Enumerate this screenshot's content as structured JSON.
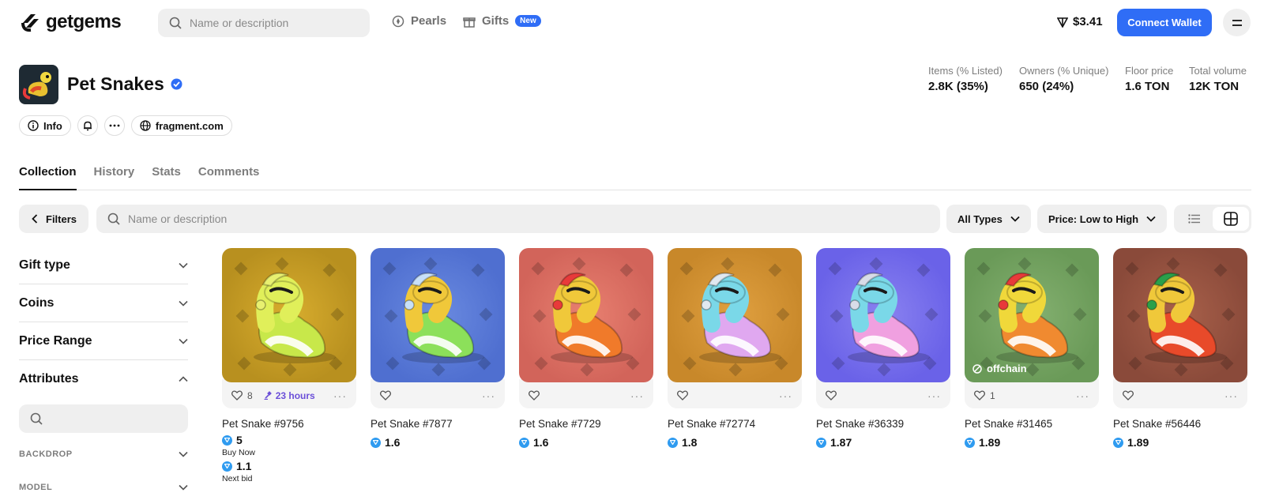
{
  "brand": {
    "name": "getgems"
  },
  "topnav": {
    "search_placeholder": "Name or description",
    "pearls_label": "Pearls",
    "gifts_label": "Gifts",
    "gifts_badge": "New",
    "balance": "$3.41",
    "connect_label": "Connect Wallet"
  },
  "collection": {
    "title": "Pet Snakes",
    "info_label": "Info",
    "website_label": "fragment.com",
    "stats": [
      {
        "label": "Items (% Listed)",
        "value": "2.8K (35%)"
      },
      {
        "label": "Owners (% Unique)",
        "value": "650 (24%)"
      },
      {
        "label": "Floor price",
        "value": "1.6 TON"
      },
      {
        "label": "Total volume",
        "value": "12K TON"
      }
    ]
  },
  "tabs": [
    "Collection",
    "History",
    "Stats",
    "Comments"
  ],
  "filterbar": {
    "filters_label": "Filters",
    "search_placeholder": "Name or description",
    "types_label": "All Types",
    "sort_label": "Price: Low to High"
  },
  "sidebar": {
    "sections": [
      "Gift type",
      "Coins",
      "Price Range",
      "Attributes"
    ],
    "subsections": [
      "BACKDROP",
      "MODEL"
    ]
  },
  "colors": {
    "accent": "#2f6df6",
    "ton": "#2f9bf0",
    "auction": "#6b4fd8"
  },
  "cards": [
    {
      "name": "Pet Snake #9756",
      "price": "5",
      "price_label": "Buy Now",
      "bid": "1.1",
      "bid_label": "Next bid",
      "likes": "8",
      "auction": "23 hours",
      "bg": "#b8901f",
      "bg2": "#d8ad2e",
      "body": "#c8e84a",
      "head": "#e0ef5a",
      "hat": "#e8f070"
    },
    {
      "name": "Pet Snake #7877",
      "price": "1.6",
      "likes": "",
      "bg": "#4f6fd0",
      "bg2": "#6a8ae0",
      "body": "#8ce05a",
      "head": "#f0c83a",
      "hat": "#c8e0f8"
    },
    {
      "name": "Pet Snake #7729",
      "price": "1.6",
      "likes": "",
      "bg": "#d2645a",
      "bg2": "#e88070",
      "body": "#f07a2a",
      "head": "#f0c83a",
      "hat": "#e83a3a"
    },
    {
      "name": "Pet Snake #72774",
      "price": "1.8",
      "likes": "",
      "bg": "#c8882a",
      "bg2": "#e0a040",
      "body": "#e0a8f0",
      "head": "#7ad8e8",
      "hat": "#e0e8f0"
    },
    {
      "name": "Pet Snake #36339",
      "price": "1.87",
      "likes": "",
      "bg": "#6a62e8",
      "bg2": "#8a82f0",
      "body": "#f0a0e0",
      "head": "#7ad8e8",
      "hat": "#d8dce8"
    },
    {
      "name": "Pet Snake #31465",
      "price": "1.89",
      "likes": "1",
      "offchain": "offchain",
      "bg": "#6a9a58",
      "bg2": "#84b070",
      "body": "#f08a30",
      "head": "#f0d83a",
      "hat": "#e83a3a"
    },
    {
      "name": "Pet Snake #56446",
      "price": "1.89",
      "likes": "",
      "bg": "#8a4a3a",
      "bg2": "#a8604a",
      "body": "#e84a2a",
      "head": "#f0c83a",
      "hat": "#2aa04a"
    }
  ]
}
